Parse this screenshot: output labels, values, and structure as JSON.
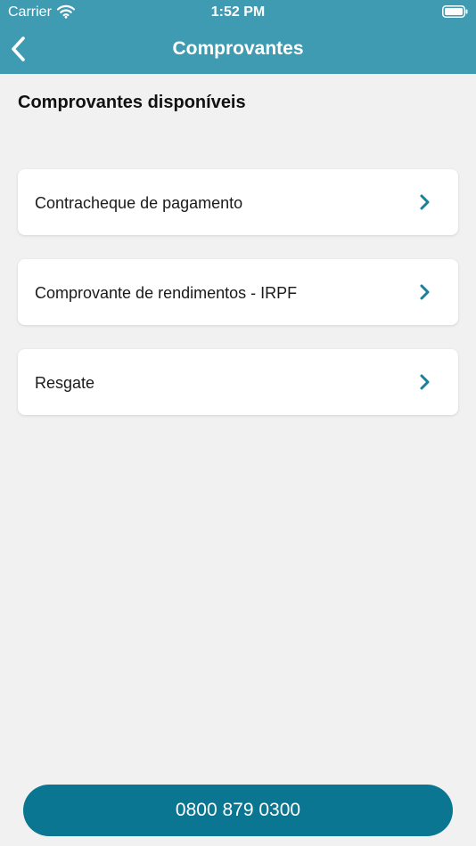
{
  "status_bar": {
    "carrier": "Carrier",
    "time": "1:52 PM"
  },
  "header": {
    "title": "Comprovantes",
    "back_icon": "chevron-left-icon"
  },
  "section_title": "Comprovantes disponíveis",
  "items": [
    {
      "label": "Contracheque de pagamento",
      "icon": "chevron-right-icon"
    },
    {
      "label": "Comprovante de rendimentos - IRPF",
      "icon": "chevron-right-icon"
    },
    {
      "label": "Resgate",
      "icon": "chevron-right-icon"
    }
  ],
  "footer": {
    "phone_label": "0800 879 0300"
  },
  "colors": {
    "header_bg": "#3f9bb2",
    "accent": "#1a7f99",
    "button_bg": "#0b7691",
    "page_bg": "#f1f1f1"
  }
}
